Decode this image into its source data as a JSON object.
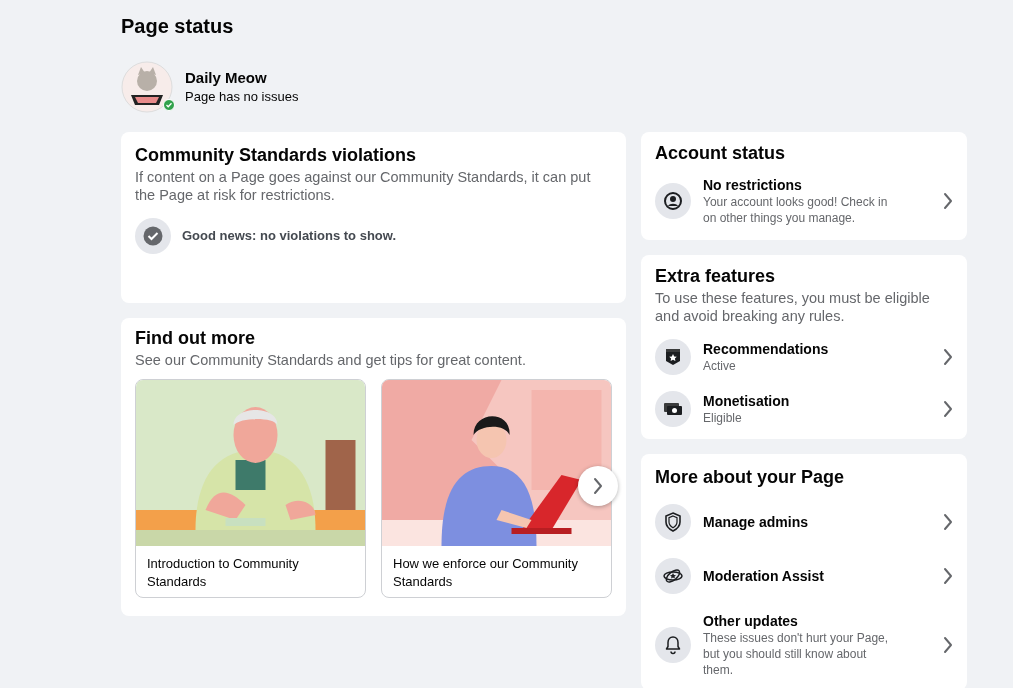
{
  "page_title": "Page status",
  "profile": {
    "name": "Daily Meow",
    "status": "Page has no issues",
    "verified": true
  },
  "violations": {
    "title": "Community Standards violations",
    "description": "If content on a Page goes against our Community Standards, it can put the Page at risk for restrictions.",
    "result": "Good news: no violations to show."
  },
  "find_out_more": {
    "title": "Find out more",
    "description": "See our Community Standards and get tips for great content.",
    "articles": [
      {
        "title": "Introduction to Community Standards"
      },
      {
        "title": "How we enforce our Community Standards"
      }
    ]
  },
  "account_status": {
    "title": "Account status",
    "items": [
      {
        "title": "No restrictions",
        "subtitle": "Your account looks good! Check in on other things you manage."
      }
    ]
  },
  "extra_features": {
    "title": "Extra features",
    "description": "To use these features, you must be eligible and avoid breaking any rules.",
    "items": [
      {
        "title": "Recommendations",
        "subtitle": "Active"
      },
      {
        "title": "Monetisation",
        "subtitle": "Eligible"
      }
    ]
  },
  "more_about": {
    "title": "More about your Page",
    "items": [
      {
        "title": "Manage admins"
      },
      {
        "title": "Moderation Assist"
      },
      {
        "title": "Other updates",
        "subtitle": "These issues don't hurt your Page, but you should still know about them."
      }
    ]
  }
}
